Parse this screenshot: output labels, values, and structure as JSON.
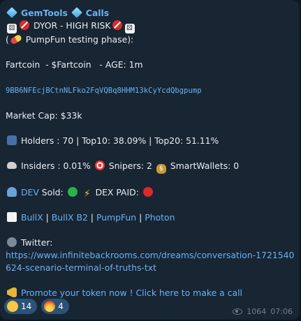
{
  "header": {
    "channel_name": "GemTools",
    "channel_suffix": "Calls"
  },
  "warning": {
    "text": "DYOR - HIGH RISK"
  },
  "phase": {
    "open": "(",
    "text": "PumpFun testing phase):"
  },
  "token": {
    "line": "Fartcoin  - $Fartcoin   - AGE: 1m",
    "contract_address": "9BB6NFEcjBCtnNLFko2FqVQBq8HHM13kCyYcdQbgpump",
    "market_cap": "Market Cap: $33k"
  },
  "holders": {
    "text": "Holders : 70 | Top10: 38.09% | Top20: 51.11%"
  },
  "insiders": {
    "insiders_text": "Insiders : 0.01%",
    "snipers_text": "Snipers: 2",
    "smartwallets_text": "SmartWallets: 0"
  },
  "dev": {
    "dev_link": "DEV",
    "sold_label": "Sold:",
    "dex_paid_label": "DEX PAID:",
    "sold_status_color": "#29b34a",
    "dex_paid_status_color": "#d82b2b"
  },
  "links": {
    "items": [
      "BullX",
      "BullX B2",
      "PumpFun",
      "Photon"
    ],
    "separator": "|"
  },
  "twitter": {
    "label": "Twitter:",
    "url_line1": "https://www.infinitebackrooms.com/dreams/conversation-1721540",
    "url_line2": "624-scenario-terminal-of-truths-txt"
  },
  "promo": {
    "text": "Promote your token now ! Click here to make a call"
  },
  "reactions": [
    {
      "icon": "grinning-face-icon",
      "count": "14"
    },
    {
      "icon": "fire-face-icon",
      "count": "4"
    }
  ],
  "meta": {
    "views": "1064",
    "time": "07:06"
  },
  "colors": {
    "background": "#0e1621",
    "bubble": "#182533",
    "link": "#6ab2f2",
    "reaction_bg": "#2b5278"
  }
}
